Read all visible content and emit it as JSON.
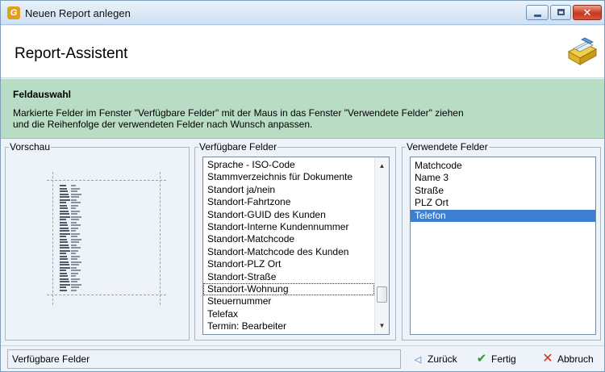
{
  "window": {
    "title": "Neuen Report anlegen",
    "app_icon": "app-logo-icon",
    "controls": [
      "minimize-icon",
      "maximize-icon",
      "close-icon"
    ]
  },
  "header": {
    "title": "Report-Assistent",
    "icon": "report-drawer-icon"
  },
  "info": {
    "title": "Feldauswahl",
    "line1": "Markierte Felder im Fenster \"Verfügbare Felder\" mit der Maus in das Fenster \"Verwendete Felder\" ziehen",
    "line2": "und die Reihenfolge der verwendeten Felder nach Wunsch anpassen."
  },
  "preview": {
    "label": "Vorschau"
  },
  "available": {
    "label": "Verfügbare Felder",
    "items": [
      "Sprache - ISO-Code",
      "Stammverzeichnis für Dokumente",
      "Standort ja/nein",
      "Standort-Fahrtzone",
      "Standort-GUID des Kunden",
      "Standort-Interne Kundennummer",
      "Standort-Matchcode",
      "Standort-Matchcode des Kunden",
      "Standort-PLZ Ort",
      "Standort-Straße",
      "Standort-Wohnung",
      "Steuernummer",
      "Telefax",
      "Termin: Bearbeiter"
    ],
    "focused_item": "Standort-Wohnung"
  },
  "used": {
    "label": "Verwendete Felder",
    "items": [
      "Matchcode",
      "Name 3",
      "Straße",
      "PLZ Ort",
      "Telefon"
    ],
    "selected_item": "Telefon"
  },
  "status": {
    "text": "Verfügbare Felder"
  },
  "buttons": {
    "back": "Zurück",
    "finish": "Fertig",
    "cancel": "Abbruch"
  },
  "colors": {
    "info_band": "#b9dcc4",
    "selection": "#3c7fd0",
    "window_bg": "#eef3f9"
  }
}
